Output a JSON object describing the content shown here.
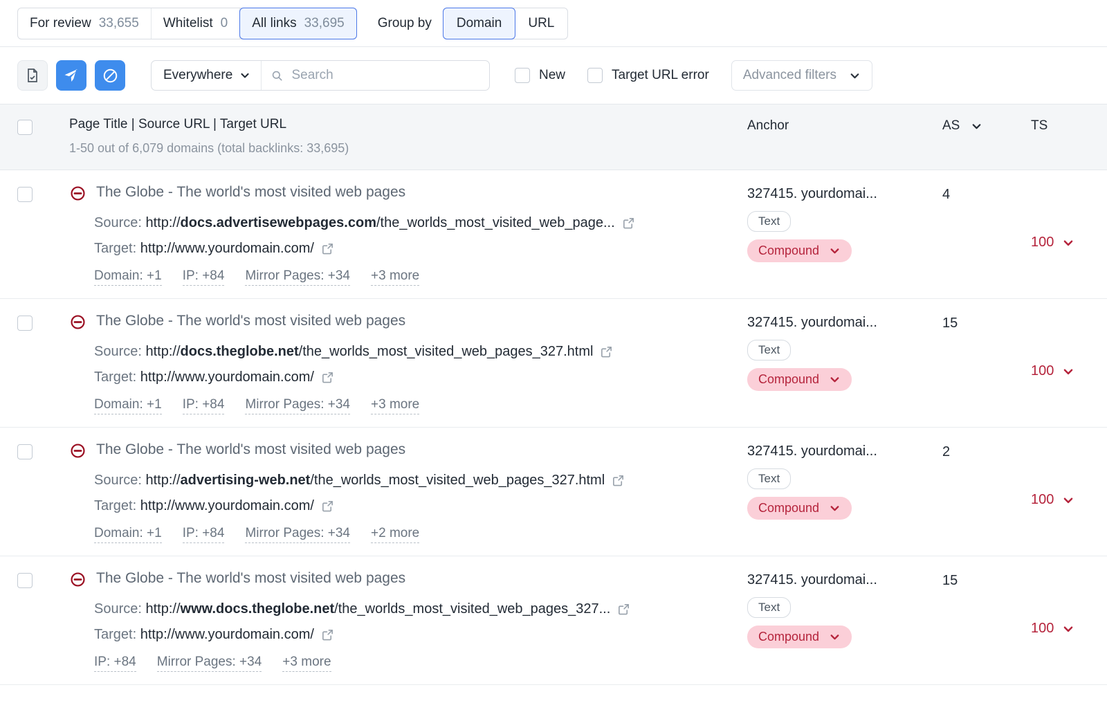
{
  "topbar": {
    "tabs": [
      {
        "label": "For review",
        "count": "33,655",
        "active": false
      },
      {
        "label": "Whitelist",
        "count": "0",
        "active": false
      },
      {
        "label": "All links",
        "count": "33,695",
        "active": true
      }
    ],
    "group_by_label": "Group by",
    "group_options": [
      {
        "label": "Domain",
        "active": true
      },
      {
        "label": "URL",
        "active": false
      }
    ]
  },
  "toolbar": {
    "icons": [
      {
        "name": "export-file-icon",
        "style": "grey"
      },
      {
        "name": "send-disavow-icon",
        "style": "blue"
      },
      {
        "name": "block-domain-icon",
        "style": "blue"
      }
    ],
    "scope_value": "Everywhere",
    "search_placeholder": "Search",
    "search_value": "",
    "checkbox_new": "New",
    "checkbox_target_url_error": "Target URL error",
    "advanced_filters": "Advanced filters"
  },
  "table": {
    "header": {
      "main": "Page Title | Source URL | Target URL",
      "subtitle": "1-50 out of 6,079 domains (total backlinks: 33,695)",
      "anchor": "Anchor",
      "as": "AS",
      "ts": "TS"
    },
    "rows": [
      {
        "title": "The Globe - The world's most visited web pages",
        "source_label": "Source:",
        "source_prefix": "http://",
        "source_domain": "docs.advertisewebpages.com",
        "source_path": "/the_worlds_most_visited_web_page...",
        "target_label": "Target:",
        "target_url": "http://www.yourdomain.com/",
        "meta": [
          "Domain: +1",
          "IP: +84",
          "Mirror Pages: +34",
          "+3 more"
        ],
        "anchor": "327415. yourdomai...",
        "badge_text": "Text",
        "badge_compound": "Compound",
        "as": "4",
        "ts": "100"
      },
      {
        "title": "The Globe - The world's most visited web pages",
        "source_label": "Source:",
        "source_prefix": "http://",
        "source_domain": "docs.theglobe.net",
        "source_path": "/the_worlds_most_visited_web_pages_327.html",
        "target_label": "Target:",
        "target_url": "http://www.yourdomain.com/",
        "meta": [
          "Domain: +1",
          "IP: +84",
          "Mirror Pages: +34",
          "+3 more"
        ],
        "anchor": "327415. yourdomai...",
        "badge_text": "Text",
        "badge_compound": "Compound",
        "as": "15",
        "ts": "100"
      },
      {
        "title": "The Globe - The world's most visited web pages",
        "source_label": "Source:",
        "source_prefix": "http://",
        "source_domain": "advertising-web.net",
        "source_path": "/the_worlds_most_visited_web_pages_327.html",
        "target_label": "Target:",
        "target_url": "http://www.yourdomain.com/",
        "meta": [
          "Domain: +1",
          "IP: +84",
          "Mirror Pages: +34",
          "+2 more"
        ],
        "anchor": "327415. yourdomai...",
        "badge_text": "Text",
        "badge_compound": "Compound",
        "as": "2",
        "ts": "100"
      },
      {
        "title": "The Globe - The world's most visited web pages",
        "source_label": "Source:",
        "source_prefix": "http://",
        "source_domain": "www.docs.theglobe.net",
        "source_path": "/the_worlds_most_visited_web_pages_327...",
        "target_label": "Target:",
        "target_url": "http://www.yourdomain.com/",
        "meta": [
          "IP: +84",
          "Mirror Pages: +34",
          "+3 more"
        ],
        "anchor": "327415. yourdomai...",
        "badge_text": "Text",
        "badge_compound": "Compound",
        "as": "15",
        "ts": "100"
      }
    ]
  },
  "colors": {
    "accent_blue": "#3e8ced",
    "active_tab_bg": "#eef4fe",
    "active_tab_border": "#4c78e8",
    "danger_red": "#b5243c",
    "badge_pink_bg": "#fbcfd8",
    "header_bg": "#f4f6f8"
  }
}
